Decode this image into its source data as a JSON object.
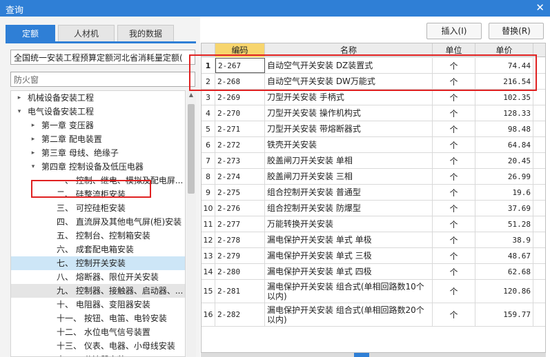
{
  "window": {
    "title": "查询"
  },
  "tabs": [
    {
      "label": "定额",
      "active": true
    },
    {
      "label": "人材机",
      "active": false
    },
    {
      "label": "我的数据",
      "active": false
    }
  ],
  "quota_select": {
    "value": "全国统一安装工程预算定额河北省消耗量定额("
  },
  "search": {
    "value": "防火窗"
  },
  "tree": [
    {
      "label": "机械设备安装工程",
      "level": 0,
      "arrow": "▸",
      "state": ""
    },
    {
      "label": "电气设备安装工程",
      "level": 0,
      "arrow": "▾",
      "state": ""
    },
    {
      "label": "第一章 变压器",
      "level": 1,
      "arrow": "▸",
      "state": ""
    },
    {
      "label": "第二章 配电装置",
      "level": 1,
      "arrow": "▸",
      "state": ""
    },
    {
      "label": "第三章 母线、绝缘子",
      "level": 1,
      "arrow": "▸",
      "state": ""
    },
    {
      "label": "第四章 控制设备及低压电器",
      "level": 1,
      "arrow": "▾",
      "state": ""
    },
    {
      "label": "一、 控制、继电、模拟及配电屏...",
      "level": 2,
      "arrow": "",
      "state": ""
    },
    {
      "label": "二、 硅整流柜安装",
      "level": 2,
      "arrow": "",
      "state": ""
    },
    {
      "label": "三、 可控硅柜安装",
      "level": 2,
      "arrow": "",
      "state": ""
    },
    {
      "label": "四、 直流屏及其他电气屏(柜)安装",
      "level": 2,
      "arrow": "",
      "state": ""
    },
    {
      "label": "五、 控制台、控制箱安装",
      "level": 2,
      "arrow": "",
      "state": ""
    },
    {
      "label": "六、 成套配电箱安装",
      "level": 2,
      "arrow": "",
      "state": ""
    },
    {
      "label": "七、 控制开关安装",
      "level": 2,
      "arrow": "",
      "state": "selected"
    },
    {
      "label": "八、 熔断器、限位开关安装",
      "level": 2,
      "arrow": "",
      "state": ""
    },
    {
      "label": "九、 控制器、接触器、启动器、...",
      "level": 2,
      "arrow": "",
      "state": "hover"
    },
    {
      "label": "十、 电阻器、变阻器安装",
      "level": 2,
      "arrow": "",
      "state": ""
    },
    {
      "label": "十一、 按钮、电笛、电铃安装",
      "level": 2,
      "arrow": "",
      "state": ""
    },
    {
      "label": "十二、 水位电气信号装置",
      "level": 2,
      "arrow": "",
      "state": ""
    },
    {
      "label": "十三、 仪表、电器、小母线安装",
      "level": 2,
      "arrow": "",
      "state": ""
    },
    {
      "label": "十四、 分流器安装",
      "level": 2,
      "arrow": "",
      "state": ""
    }
  ],
  "toolbar": {
    "insert_label": "插入(I)",
    "replace_label": "替换(R)"
  },
  "grid": {
    "columns": [
      "",
      "编码",
      "名称",
      "单位",
      "单价"
    ],
    "rows": [
      {
        "idx": "1",
        "code": "2-267",
        "name": "自动空气开关安装 DZ装置式",
        "unit": "个",
        "price": "74.44"
      },
      {
        "idx": "2",
        "code": "2-268",
        "name": "自动空气开关安装 DW万能式",
        "unit": "个",
        "price": "216.54"
      },
      {
        "idx": "3",
        "code": "2-269",
        "name": "刀型开关安装 手柄式",
        "unit": "个",
        "price": "102.35"
      },
      {
        "idx": "4",
        "code": "2-270",
        "name": "刀型开关安装 操作机构式",
        "unit": "个",
        "price": "128.33"
      },
      {
        "idx": "5",
        "code": "2-271",
        "name": "刀型开关安装 带熔断器式",
        "unit": "个",
        "price": "98.48"
      },
      {
        "idx": "6",
        "code": "2-272",
        "name": "铁壳开关安装",
        "unit": "个",
        "price": "64.84"
      },
      {
        "idx": "7",
        "code": "2-273",
        "name": "胶盖闸刀开关安装 单相",
        "unit": "个",
        "price": "20.45"
      },
      {
        "idx": "8",
        "code": "2-274",
        "name": "胶盖闸刀开关安装 三相",
        "unit": "个",
        "price": "26.99"
      },
      {
        "idx": "9",
        "code": "2-275",
        "name": "组合控制开关安装 普通型",
        "unit": "个",
        "price": "19.6"
      },
      {
        "idx": "10",
        "code": "2-276",
        "name": "组合控制开关安装 防爆型",
        "unit": "个",
        "price": "37.69"
      },
      {
        "idx": "11",
        "code": "2-277",
        "name": "万能转换开关安装",
        "unit": "个",
        "price": "51.28"
      },
      {
        "idx": "12",
        "code": "2-278",
        "name": "漏电保护开关安装 单式 单极",
        "unit": "个",
        "price": "38.9"
      },
      {
        "idx": "13",
        "code": "2-279",
        "name": "漏电保护开关安装 单式 三极",
        "unit": "个",
        "price": "48.67"
      },
      {
        "idx": "14",
        "code": "2-280",
        "name": "漏电保护开关安装 单式 四极",
        "unit": "个",
        "price": "62.68"
      },
      {
        "idx": "15",
        "code": "2-281",
        "name": "漏电保护开关安装 组合式(单相回路数10个以内)",
        "unit": "个",
        "price": "120.86"
      },
      {
        "idx": "16",
        "code": "2-282",
        "name": "漏电保护开关安装 组合式(单相回路数20个以内)",
        "unit": "个",
        "price": "159.77"
      }
    ]
  },
  "icons": {
    "close": "close-icon",
    "expand": "chevron-right-icon",
    "collapse": "chevron-down-icon"
  },
  "colors": {
    "accent": "#2f7fd6",
    "highlight_box": "#e02020",
    "active_header": "#f7d56e",
    "selected_row": "#cde6f7"
  }
}
